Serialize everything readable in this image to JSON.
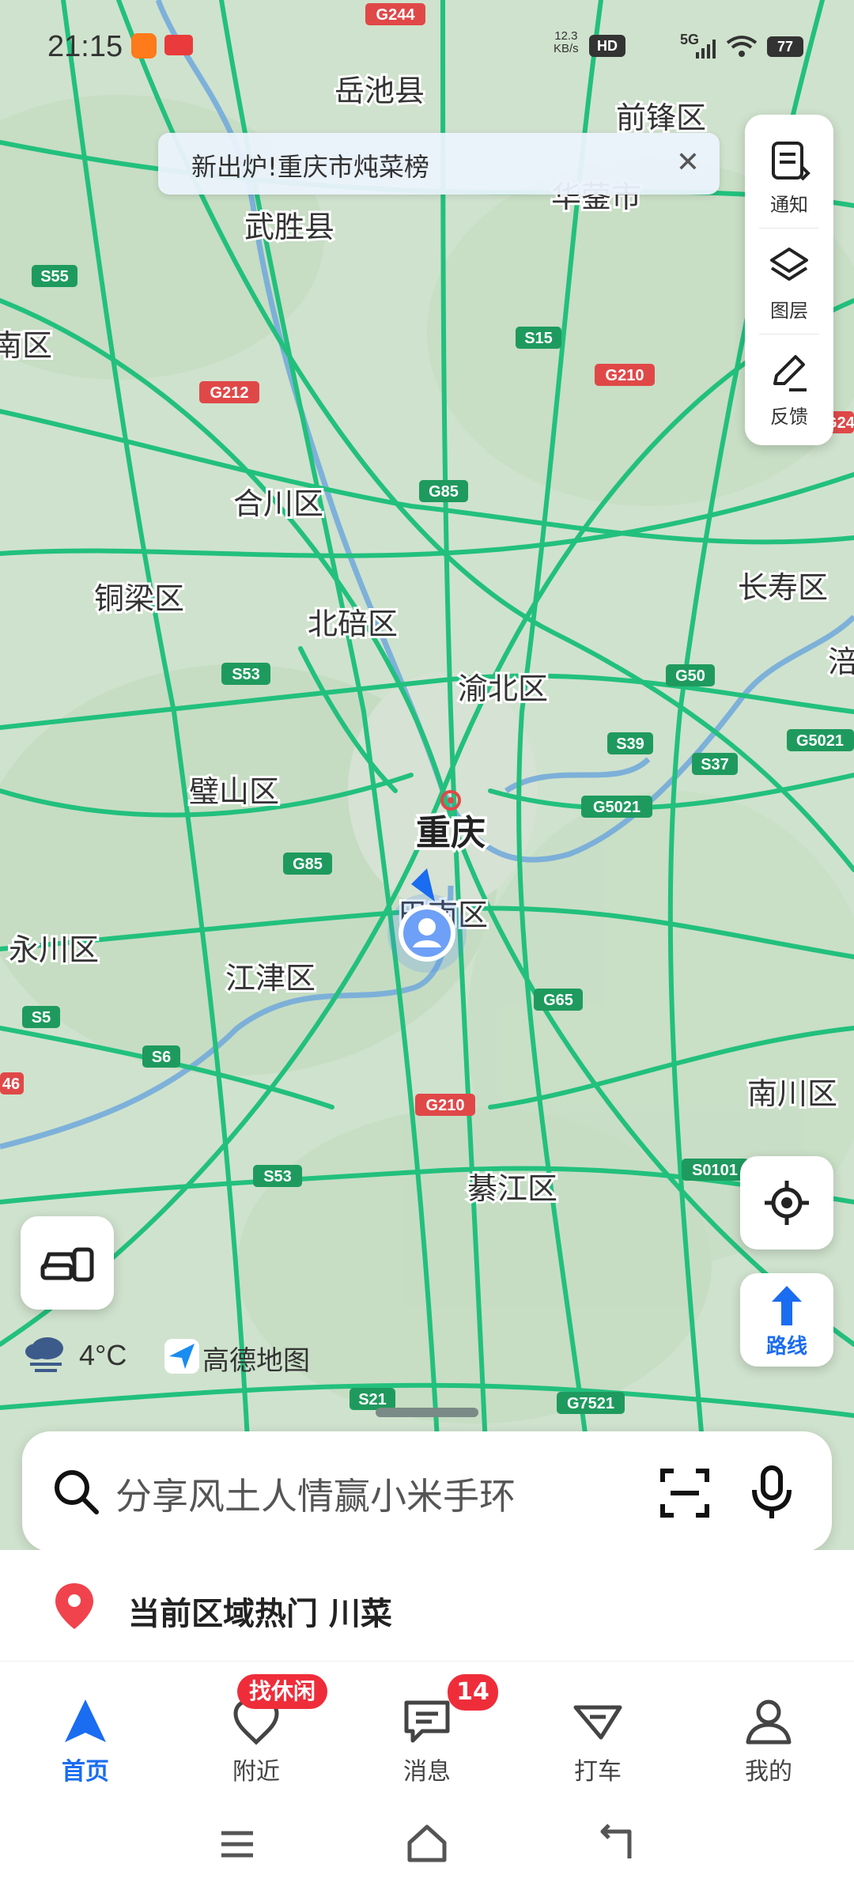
{
  "status_bar": {
    "time": "21:15",
    "speed_value": "12.3",
    "speed_unit": "KB/s",
    "network_badge": "HD",
    "signal": "5G",
    "battery": "77"
  },
  "banner": {
    "text": "新出炉!重庆市炖菜榜",
    "close_glyph": "✕"
  },
  "tools": [
    {
      "label": "通知"
    },
    {
      "label": "图层"
    },
    {
      "label": "反馈"
    }
  ],
  "map": {
    "city_label": "重庆",
    "district_labels": [
      "岳池县",
      "前锋区",
      "华蓥市",
      "武胜县",
      "南区",
      "合川区",
      "铜梁区",
      "北碚区",
      "长寿区",
      "渝北区",
      "璧山区",
      "永川区",
      "江津区",
      "南川区",
      "綦江区",
      "巴南区",
      "涪"
    ],
    "road_shields": [
      "G244",
      "S55",
      "G212",
      "S15",
      "G210",
      "G85",
      "S53",
      "G50",
      "S39",
      "S37",
      "G5021",
      "G5021",
      "G85",
      "G65",
      "S5",
      "S6",
      "G210",
      "S53",
      "S0101",
      "S21",
      "G7521",
      "46",
      "G24"
    ]
  },
  "route_button": {
    "label": "路线"
  },
  "weather": {
    "temp": "4°C",
    "brand": "高德地图"
  },
  "search": {
    "placeholder": "分享风土人情赢小米手环"
  },
  "hot": {
    "text": "当前区域热门 川菜"
  },
  "tabs": [
    {
      "label": "首页",
      "active": true
    },
    {
      "label": "附近",
      "badge": "找休闲"
    },
    {
      "label": "消息",
      "badge": "14"
    },
    {
      "label": "打车"
    },
    {
      "label": "我的"
    }
  ],
  "colors": {
    "accent": "#1a6cf0",
    "badge_red": "#ef2d3a",
    "road_green": "#1fbf7a",
    "map_bg": "#cfe3cf"
  }
}
